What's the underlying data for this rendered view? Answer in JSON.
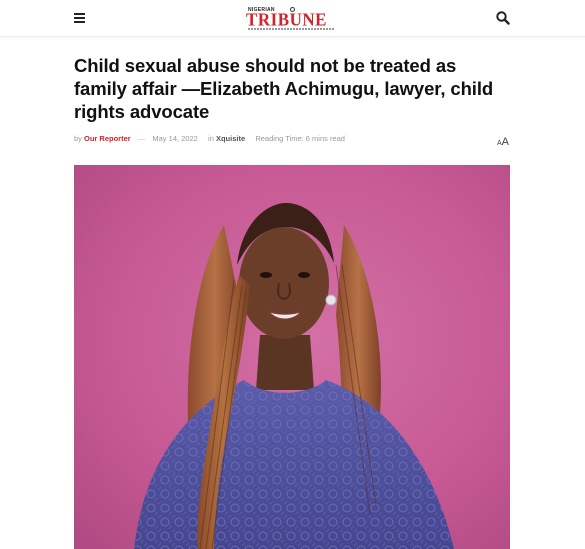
{
  "header": {
    "menu_icon": "hamburger-menu-icon",
    "logo": {
      "top_text": "NIGERIAN",
      "word": "TRIBUNE"
    },
    "search_icon": "search-icon"
  },
  "article": {
    "headline": "Child sexual abuse should not be treated as family affair —Elizabeth Achimugu, lawyer, child rights advocate",
    "meta": {
      "by": "by",
      "author": "Our Reporter",
      "dash": "—",
      "date": "May 14, 2022",
      "in": "in",
      "category": "Xquisite",
      "reading_time": "Reading Time: 6 mins read"
    },
    "font_toggle": {
      "small": "A",
      "big": "A"
    },
    "image_icon": "portrait-photo"
  },
  "colors": {
    "brand_red": "#d2232a",
    "photo_background": "#c85a95",
    "dress": "#4f4f9e"
  }
}
